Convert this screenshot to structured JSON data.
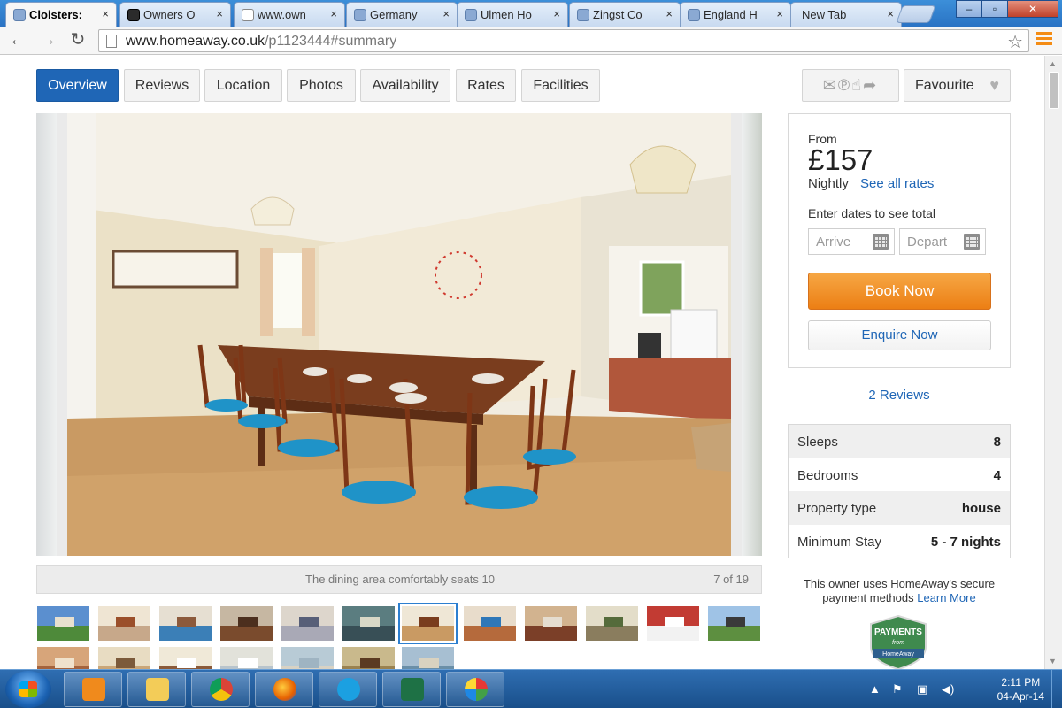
{
  "browser": {
    "tabs": [
      {
        "label": "Cloisters:",
        "active": true,
        "icon": "homeaway-icon"
      },
      {
        "label": "Owners O",
        "active": false,
        "icon": "owners-site-icon"
      },
      {
        "label": "www.own",
        "active": false,
        "icon": "document-icon"
      },
      {
        "label": "Germany",
        "active": false,
        "icon": "homeaway-icon"
      },
      {
        "label": "Ulmen Ho",
        "active": false,
        "icon": "homeaway-icon"
      },
      {
        "label": "Zingst Co",
        "active": false,
        "icon": "homeaway-icon"
      },
      {
        "label": "England H",
        "active": false,
        "icon": "homeaway-icon"
      },
      {
        "label": "New Tab",
        "active": false,
        "icon": "none"
      }
    ],
    "close_glyph": "×",
    "url_domain": "www.homeaway.co.uk",
    "url_path": "/p1123444#summary"
  },
  "nav": {
    "tabs": [
      "Overview",
      "Reviews",
      "Location",
      "Photos",
      "Availability",
      "Rates",
      "Facilities"
    ],
    "favourite_label": "Favourite"
  },
  "gallery": {
    "caption": "The dining area comfortably seats 10",
    "counter": "7 of 19",
    "thumbnail_count": 19,
    "selected_index": 7
  },
  "booking": {
    "from_label": "From",
    "price": "£157",
    "period": "Nightly",
    "see_rates_link": "See all rates",
    "dates_prompt": "Enter dates to see total",
    "arrive_placeholder": "Arrive",
    "depart_placeholder": "Depart",
    "book_now_label": "Book Now",
    "enquire_label": "Enquire Now"
  },
  "reviews_link": "2 Reviews",
  "facts": [
    {
      "label": "Sleeps",
      "value": "8"
    },
    {
      "label": "Bedrooms",
      "value": "4"
    },
    {
      "label": "Property type",
      "value": "house"
    },
    {
      "label": "Minimum Stay",
      "value": "5 - 7 nights"
    }
  ],
  "secure_payment": {
    "text": "This owner uses HomeAway's secure payment methods",
    "link": "Learn More",
    "badge_title": "PAYMENTS",
    "badge_sub": "from",
    "badge_brand": "HomeAway"
  },
  "taskbar": {
    "time": "2:11 PM",
    "date": "04-Apr-14",
    "apps": [
      "media-player-icon",
      "file-explorer-icon",
      "chrome-icon",
      "firefox-icon",
      "skype-icon",
      "excel-icon",
      "paint-icon"
    ]
  },
  "colors": {
    "primary_blue": "#1f66b6",
    "book_orange": "#ec7f14",
    "taskbar_blue": "#194f8a"
  }
}
